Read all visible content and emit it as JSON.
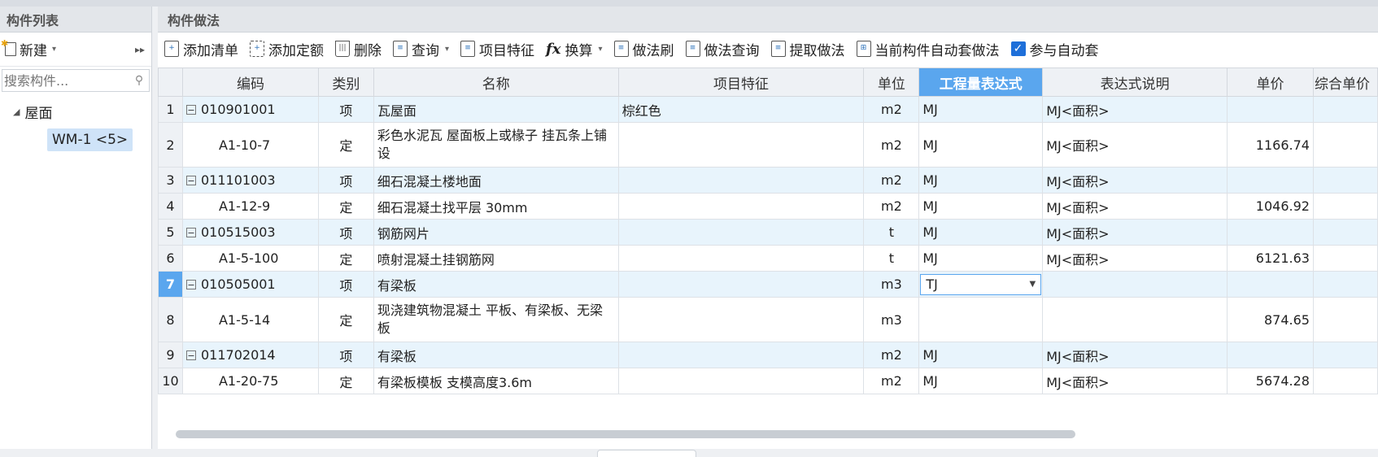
{
  "left_panel": {
    "title": "构件列表",
    "new_label": "新建",
    "search_placeholder": "搜索构件...",
    "tree_root": "屋面",
    "tree_child": "WM-1 <5>"
  },
  "right_panel": {
    "title": "构件做法",
    "toolbar": {
      "add_list": "添加清单",
      "add_quota": "添加定额",
      "delete": "删除",
      "query": "查询",
      "feature": "项目特征",
      "convert": "换算",
      "method_brush": "做法刷",
      "method_query": "做法查询",
      "extract": "提取做法",
      "auto_method": "当前构件自动套做法",
      "participate": "参与自动套"
    },
    "columns": [
      "",
      "编码",
      "类别",
      "名称",
      "项目特征",
      "单位",
      "工程量表达式",
      "表达式说明",
      "单价",
      "综合单价"
    ],
    "rows": [
      {
        "n": "1",
        "code": "010901001",
        "type": "项",
        "name": "瓦屋面",
        "feature": "棕红色",
        "unit": "m2",
        "expr": "MJ",
        "desc": "MJ<面积>",
        "price": ""
      },
      {
        "n": "2",
        "code": "A1-10-7",
        "type": "定",
        "name": "彩色水泥瓦 屋面板上或椽子 挂瓦条上铺设",
        "feature": "",
        "unit": "m2",
        "expr": "MJ",
        "desc": "MJ<面积>",
        "price": "1166.74"
      },
      {
        "n": "3",
        "code": "011101003",
        "type": "项",
        "name": "细石混凝土楼地面",
        "feature": "",
        "unit": "m2",
        "expr": "MJ",
        "desc": "MJ<面积>",
        "price": ""
      },
      {
        "n": "4",
        "code": "A1-12-9",
        "type": "定",
        "name": "细石混凝土找平层 30mm",
        "feature": "",
        "unit": "m2",
        "expr": "MJ",
        "desc": "MJ<面积>",
        "price": "1046.92"
      },
      {
        "n": "5",
        "code": "010515003",
        "type": "项",
        "name": "钢筋网片",
        "feature": "",
        "unit": "t",
        "expr": "MJ",
        "desc": "MJ<面积>",
        "price": ""
      },
      {
        "n": "6",
        "code": "A1-5-100",
        "type": "定",
        "name": "喷射混凝土挂钢筋网",
        "feature": "",
        "unit": "t",
        "expr": "MJ",
        "desc": "MJ<面积>",
        "price": "6121.63"
      },
      {
        "n": "7",
        "code": "010505001",
        "type": "项",
        "name": "有梁板",
        "feature": "",
        "unit": "m3",
        "expr": "TJ",
        "desc": "",
        "price": ""
      },
      {
        "n": "8",
        "code": "A1-5-14",
        "type": "定",
        "name": "现浇建筑物混凝土 平板、有梁板、无梁板",
        "feature": "",
        "unit": "m3",
        "expr": "",
        "desc": "",
        "price": "874.65"
      },
      {
        "n": "9",
        "code": "011702014",
        "type": "项",
        "name": "有梁板",
        "feature": "",
        "unit": "m2",
        "expr": "MJ",
        "desc": "MJ<面积>",
        "price": ""
      },
      {
        "n": "10",
        "code": "A1-20-75",
        "type": "定",
        "name": "有梁板模板 支模高度3.6m",
        "feature": "",
        "unit": "m2",
        "expr": "MJ",
        "desc": "MJ<面积>",
        "price": "5674.28"
      }
    ]
  }
}
